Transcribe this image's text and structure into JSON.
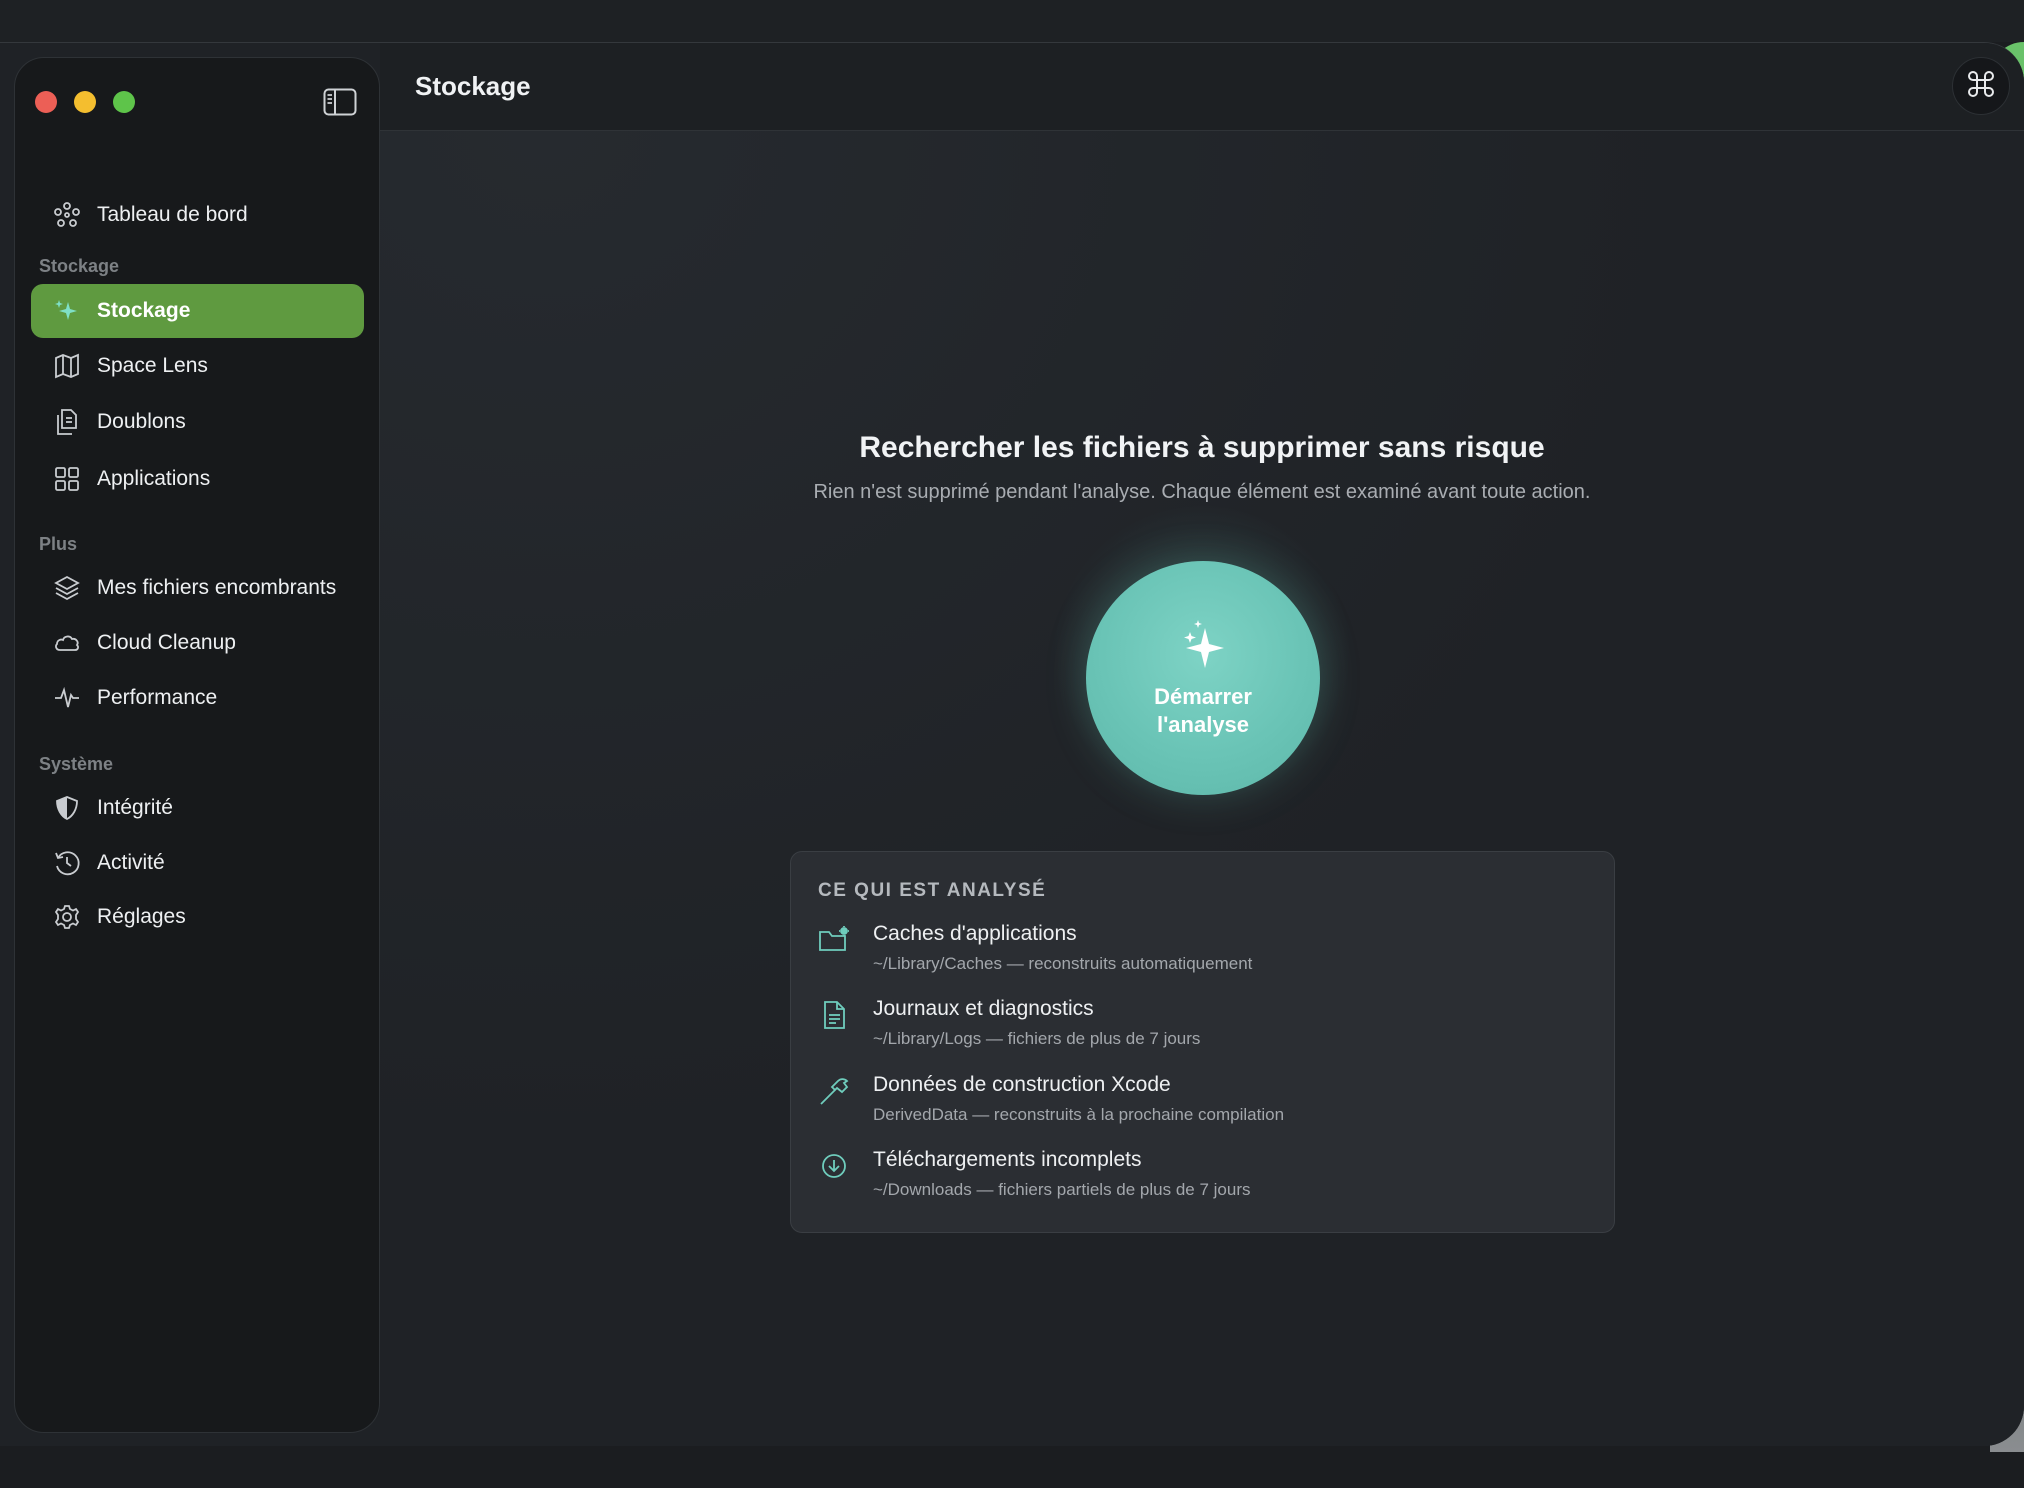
{
  "window": {
    "title": "Stockage"
  },
  "sidebar": {
    "top_item": {
      "label": "Tableau de bord",
      "icon": "dashboard-icon"
    },
    "sections": [
      {
        "label": "Stockage",
        "items": [
          {
            "label": "Stockage",
            "icon": "sparkles-icon",
            "active": true
          },
          {
            "label": "Space Lens",
            "icon": "map-icon"
          },
          {
            "label": "Doublons",
            "icon": "duplicate-files-icon"
          },
          {
            "label": "Applications",
            "icon": "grid-icon"
          }
        ]
      },
      {
        "label": "Plus",
        "items": [
          {
            "label": "Mes fichiers encombrants",
            "icon": "layers-icon"
          },
          {
            "label": "Cloud Cleanup",
            "icon": "cloud-icon"
          },
          {
            "label": "Performance",
            "icon": "pulse-icon"
          }
        ]
      },
      {
        "label": "Système",
        "items": [
          {
            "label": "Intégrité",
            "icon": "shield-icon"
          },
          {
            "label": "Activité",
            "icon": "history-icon"
          },
          {
            "label": "Réglages",
            "icon": "gear-icon"
          }
        ]
      }
    ]
  },
  "main": {
    "headline": "Rechercher les fichiers à supprimer sans risque",
    "subline": "Rien n'est supprimé pendant l'analyse. Chaque élément est examiné avant toute action.",
    "scan_button": {
      "label": "Démarrer l'analyse",
      "icon": "sparkles-icon"
    },
    "panel": {
      "title": "CE QUI EST ANALYSÉ",
      "items": [
        {
          "title": "Caches d'applications",
          "subtitle": "~/Library/Caches — reconstruits automatiquement",
          "icon": "folder-gear-icon"
        },
        {
          "title": "Journaux et diagnostics",
          "subtitle": "~/Library/Logs — fichiers de plus de 7 jours",
          "icon": "document-icon"
        },
        {
          "title": "Données de construction Xcode",
          "subtitle": "DerivedData — reconstruits à la prochaine compilation",
          "icon": "hammer-icon"
        },
        {
          "title": "Téléchargements incomplets",
          "subtitle": "~/Downloads — fichiers partiels de plus de 7 jours",
          "icon": "download-circle-icon"
        }
      ]
    }
  },
  "colors": {
    "accent_green": "#5f9a40",
    "teal": "#6ac4b6",
    "background": "#1f2226",
    "sidebar": "#17191b"
  }
}
